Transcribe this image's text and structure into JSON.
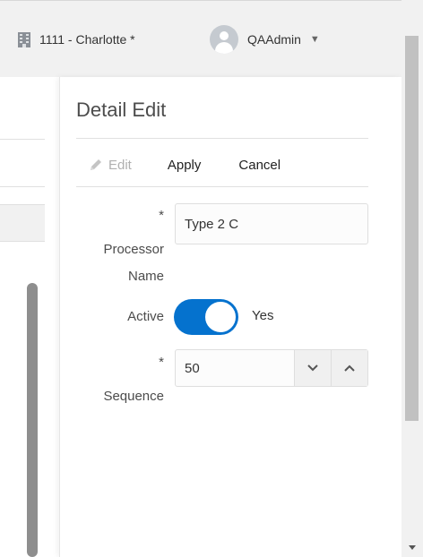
{
  "header": {
    "location": "1111 - Charlotte *",
    "user": "QAAdmin"
  },
  "panel": {
    "title": "Detail Edit",
    "toolbar": {
      "edit_label": "Edit",
      "apply_label": "Apply",
      "cancel_label": "Cancel"
    },
    "fields": {
      "processor_name": {
        "required_mark": "*",
        "label_line1": "Processor",
        "label_line2": "Name",
        "value": "Type 2 C"
      },
      "active": {
        "label": "Active",
        "on": true,
        "value_label": "Yes"
      },
      "sequence": {
        "required_mark": "*",
        "label": "Sequence",
        "value": "50"
      }
    }
  },
  "colors": {
    "accent": "#0572ce",
    "header_bg": "#f1f1f1",
    "disabled_text": "#b0b0b0"
  },
  "icons": {
    "location": "building-icon",
    "avatar": "user-avatar-icon",
    "user_menu": "caret-down-icon",
    "edit": "pencil-icon",
    "decrement": "chevron-down-icon",
    "increment": "chevron-up-icon"
  }
}
